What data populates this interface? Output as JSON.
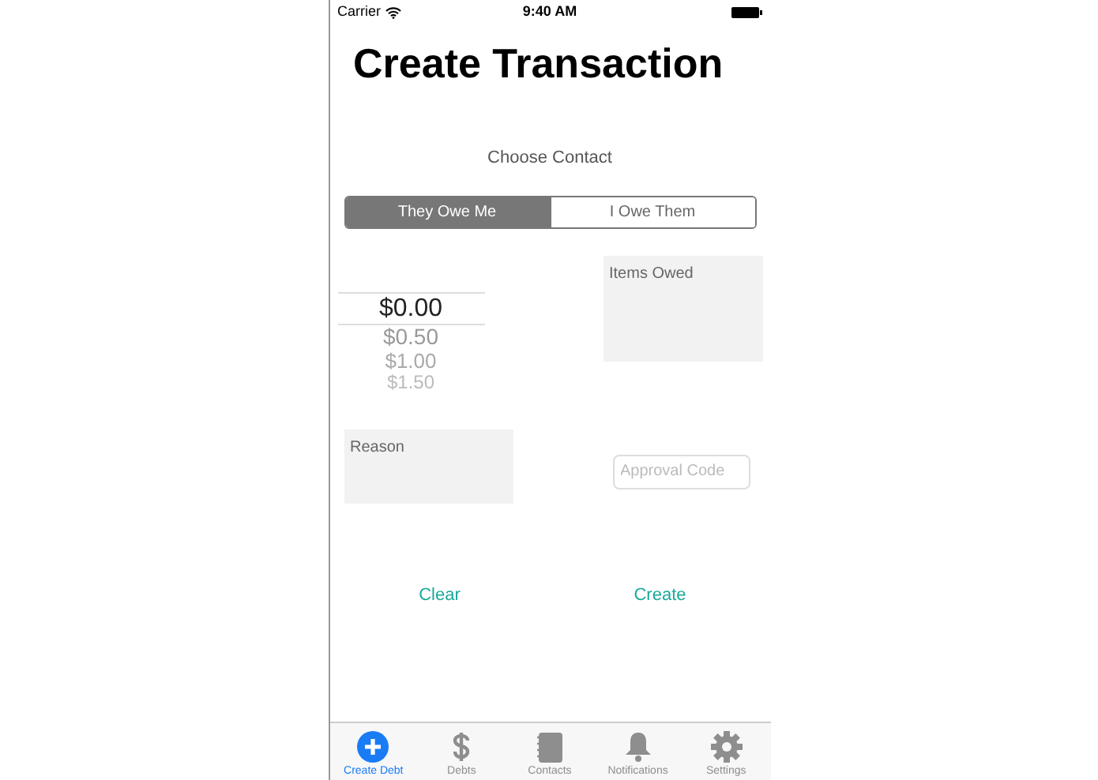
{
  "status_bar": {
    "carrier": "Carrier",
    "time": "9:40 AM"
  },
  "title": "Create Transaction",
  "contact_label": "Choose Contact",
  "segments": [
    {
      "label": "They Owe Me",
      "selected": true
    },
    {
      "label": "I Owe Them",
      "selected": false
    }
  ],
  "amount_picker": [
    {
      "label": "$0.00",
      "selected": true
    },
    {
      "label": "$0.50",
      "selected": false
    },
    {
      "label": "$1.00",
      "selected": false
    },
    {
      "label": "$1.50",
      "selected": false
    }
  ],
  "items_owed": {
    "placeholder": "Items Owed"
  },
  "reason": {
    "placeholder": "Reason"
  },
  "approval_code": {
    "placeholder": "Approval Code"
  },
  "buttons": [
    "Clear",
    "Create"
  ],
  "tab_bar": [
    {
      "label": "Create Debt",
      "selected": true
    },
    {
      "label": "Debts",
      "selected": false
    },
    {
      "label": "Contacts",
      "selected": false
    },
    {
      "label": "Notifications",
      "selected": false
    },
    {
      "label": "Settings",
      "selected": false
    }
  ]
}
